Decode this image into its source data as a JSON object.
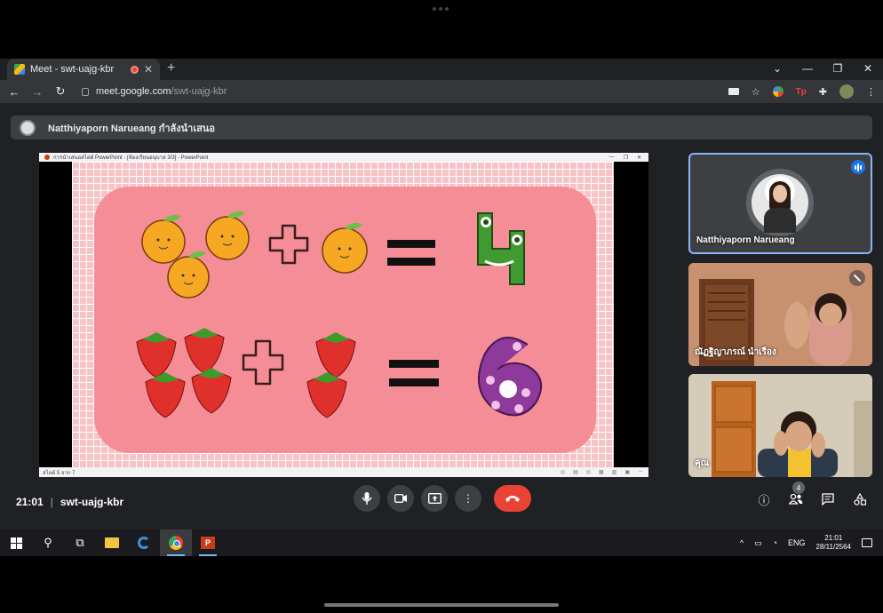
{
  "browser": {
    "tab_title": "Meet - swt-uajg-kbr",
    "url_host": "meet.google.com",
    "url_path": "/swt-uajg-kbr",
    "new_tab": "+",
    "win_min": "—",
    "win_restore": "❐",
    "win_close": "✕",
    "tab_dropdown": "⌄"
  },
  "meet": {
    "presenting_banner": "Natthiyaporn Narueang กำลังนำเสนอ",
    "meeting_time": "21:01",
    "meeting_code": "swt-uajg-kbr",
    "people_count": "4",
    "participants": [
      {
        "name": "Natthiyaporn Narueang",
        "speaking": true
      },
      {
        "name": "ณัฏฐิญาภรณ์ นำเรือง",
        "muted": true
      },
      {
        "name": "คุณ",
        "muted": false
      }
    ]
  },
  "presentation": {
    "window_title": "การนำเสนอสไลด์ PowerPoint - [ห้องเรียนอนุบาล 3/3] - PowerPoint",
    "slide_indicator": "สไลด์ 5 จาก 7",
    "row1": {
      "fruit": "orange",
      "left_count": 3,
      "right_count": 1,
      "result": "4"
    },
    "row2": {
      "fruit": "strawberry",
      "left_count": 4,
      "right_count": 2,
      "result": "6"
    },
    "plus_symbol": "+",
    "equals_symbol": "="
  },
  "taskbar": {
    "lang": "ENG",
    "time": "21:01",
    "date": "28/11/2564"
  },
  "colors": {
    "meet_bg": "#202124",
    "end_call": "#ea4335",
    "active_speaker_border": "#8ab4f8",
    "slide_pink": "#f48d95"
  }
}
